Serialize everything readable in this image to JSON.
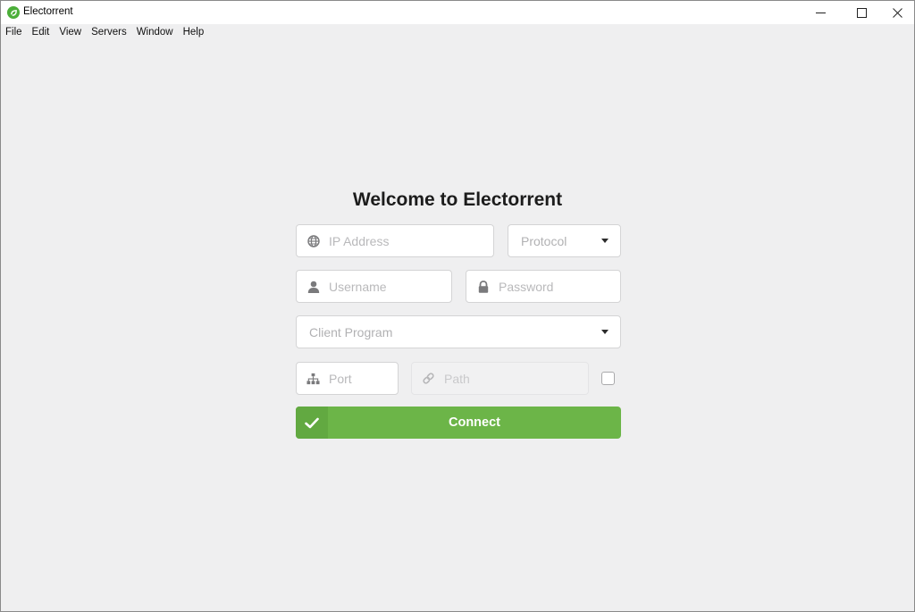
{
  "window": {
    "title": "Electorrent",
    "controls": {
      "minimize_icon": "minimize-icon",
      "maximize_icon": "maximize-icon",
      "close_icon": "close-icon"
    }
  },
  "menubar": {
    "items": [
      "File",
      "Edit",
      "View",
      "Servers",
      "Window",
      "Help"
    ]
  },
  "form": {
    "heading": "Welcome to Electorrent",
    "ip_address": {
      "placeholder": "IP Address",
      "value": "",
      "icon": "globe-icon"
    },
    "protocol": {
      "selected": "Protocol",
      "icon": "caret-down-icon"
    },
    "username": {
      "placeholder": "Username",
      "value": "",
      "icon": "user-icon"
    },
    "password": {
      "placeholder": "Password",
      "value": "",
      "icon": "lock-icon"
    },
    "client_program": {
      "selected": "Client Program",
      "icon": "caret-down-icon"
    },
    "port": {
      "placeholder": "Port",
      "value": "",
      "icon": "sitemap-icon"
    },
    "path": {
      "placeholder": "Path",
      "value": "",
      "icon": "link-icon",
      "disabled": true
    },
    "path_checkbox": {
      "checked": false
    },
    "connect_button": {
      "label": "Connect",
      "icon": "check-icon"
    }
  },
  "colors": {
    "accent": "#6cb548",
    "accent_dark": "#62a941",
    "background": "#efeff0"
  }
}
